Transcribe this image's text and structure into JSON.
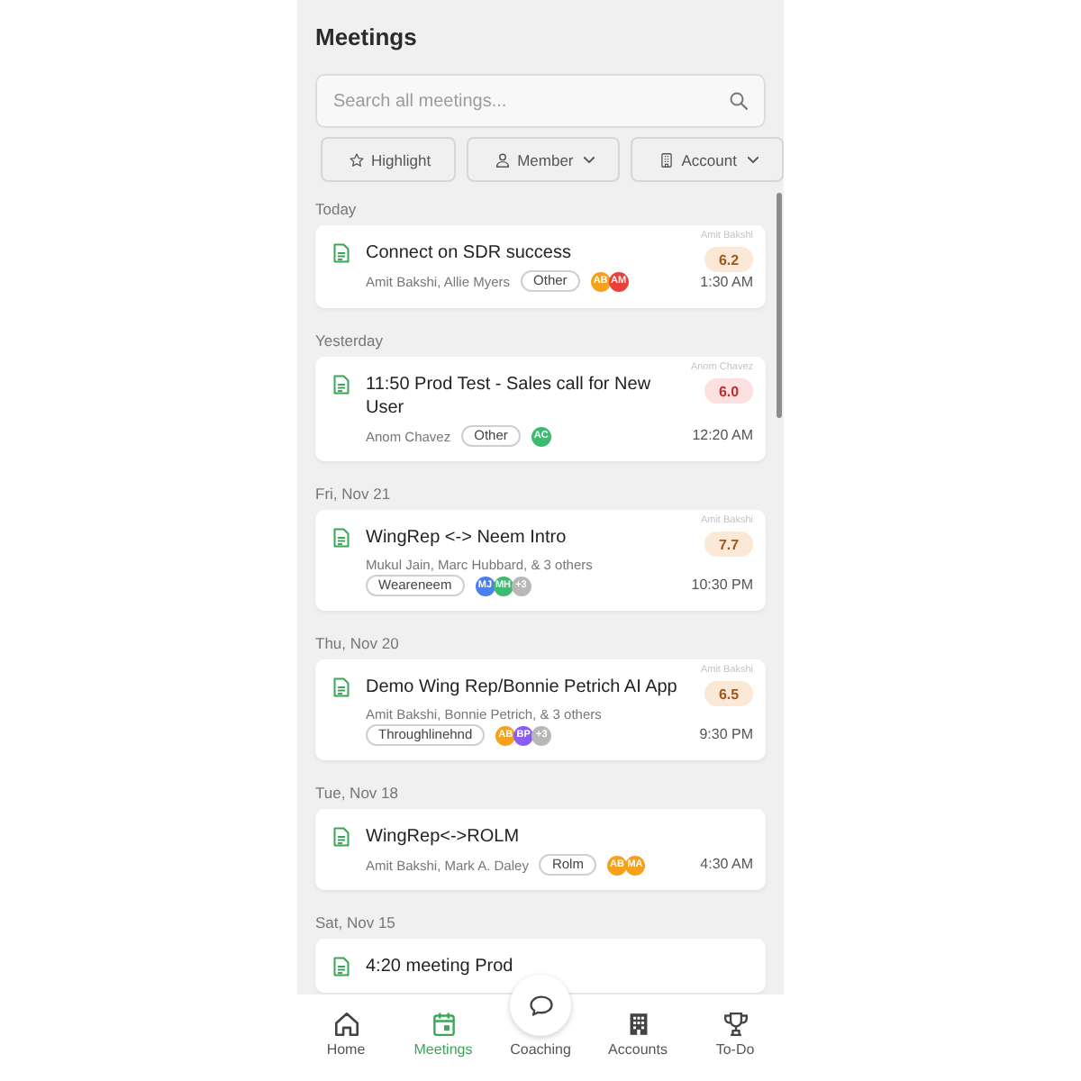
{
  "header": {
    "title": "Meetings"
  },
  "search": {
    "placeholder": "Search all meetings..."
  },
  "filters": [
    {
      "label": "Highlight",
      "kind": "star",
      "dropdown": false
    },
    {
      "label": "Member",
      "kind": "person",
      "dropdown": true
    },
    {
      "label": "Account",
      "kind": "building",
      "dropdown": true
    }
  ],
  "groups": [
    {
      "date": "Today",
      "meetings": [
        {
          "title": "Connect on SDR success",
          "participants": "Amit Bakshi, Allie Myers",
          "tag": "Other",
          "avatars": [
            {
              "initials": "AB",
              "color": "#f5a11c"
            },
            {
              "initials": "AM",
              "color": "#e8413c"
            }
          ],
          "owner": "Amit Bakshi",
          "score": {
            "text": "6.2",
            "kind": "fair"
          },
          "time": "1:30 AM"
        }
      ]
    },
    {
      "date": "Yesterday",
      "meetings": [
        {
          "title": "11:50 Prod Test - Sales call for New User",
          "participants": "Anom Chavez",
          "tag": "Other",
          "avatars": [
            {
              "initials": "AC",
              "color": "#3dba6f"
            }
          ],
          "owner": "Anom Chavez",
          "score": {
            "text": "6.0",
            "kind": "low"
          },
          "time": "12:20 AM"
        }
      ]
    },
    {
      "date": "Fri, Nov 21",
      "meetings": [
        {
          "title": "WingRep <-> Neem Intro",
          "participants": "Mukul Jain, Marc Hubbard, & 3 others",
          "tag": "Weareneem",
          "avatars": [
            {
              "initials": "MJ",
              "color": "#4a7ff0"
            },
            {
              "initials": "MH",
              "color": "#3dba6f"
            },
            {
              "initials": "+3",
              "color": "#b8b8b8"
            }
          ],
          "owner": "Amit Bakshi",
          "score": {
            "text": "7.7",
            "kind": "fair"
          },
          "time": "10:30 PM"
        }
      ]
    },
    {
      "date": "Thu, Nov 20",
      "meetings": [
        {
          "title": "Demo Wing Rep/Bonnie Petrich AI App",
          "participants": "Amit Bakshi, Bonnie Petrich, & 3 others",
          "tag": "Throughlinehnd",
          "avatars": [
            {
              "initials": "AB",
              "color": "#f5a11c"
            },
            {
              "initials": "BP",
              "color": "#8b5cf6"
            },
            {
              "initials": "+3",
              "color": "#b8b8b8"
            }
          ],
          "owner": "Amit Bakshi",
          "score": {
            "text": "6.5",
            "kind": "fair"
          },
          "time": "9:30 PM"
        }
      ]
    },
    {
      "date": "Tue, Nov 18",
      "meetings": [
        {
          "title": "WingRep<->ROLM",
          "participants": "Amit Bakshi, Mark A. Daley",
          "tag": "Rolm",
          "avatars": [
            {
              "initials": "AB",
              "color": "#f5a11c"
            },
            {
              "initials": "MA",
              "color": "#f5a11c"
            }
          ],
          "time": "4:30 AM"
        }
      ]
    },
    {
      "date": "Sat, Nov 15",
      "meetings": [
        {
          "title": "4:20 meeting Prod"
        }
      ]
    }
  ],
  "nav": [
    {
      "label": "Home",
      "kind": "home",
      "raised": false,
      "selected": false
    },
    {
      "label": "Meetings",
      "kind": "calendar",
      "raised": false,
      "selected": true
    },
    {
      "label": "Coaching",
      "kind": "chat",
      "raised": true,
      "selected": false
    },
    {
      "label": "Accounts",
      "kind": "building",
      "raised": false,
      "selected": false
    },
    {
      "label": "To-Do",
      "kind": "trophy",
      "raised": false,
      "selected": false
    }
  ]
}
